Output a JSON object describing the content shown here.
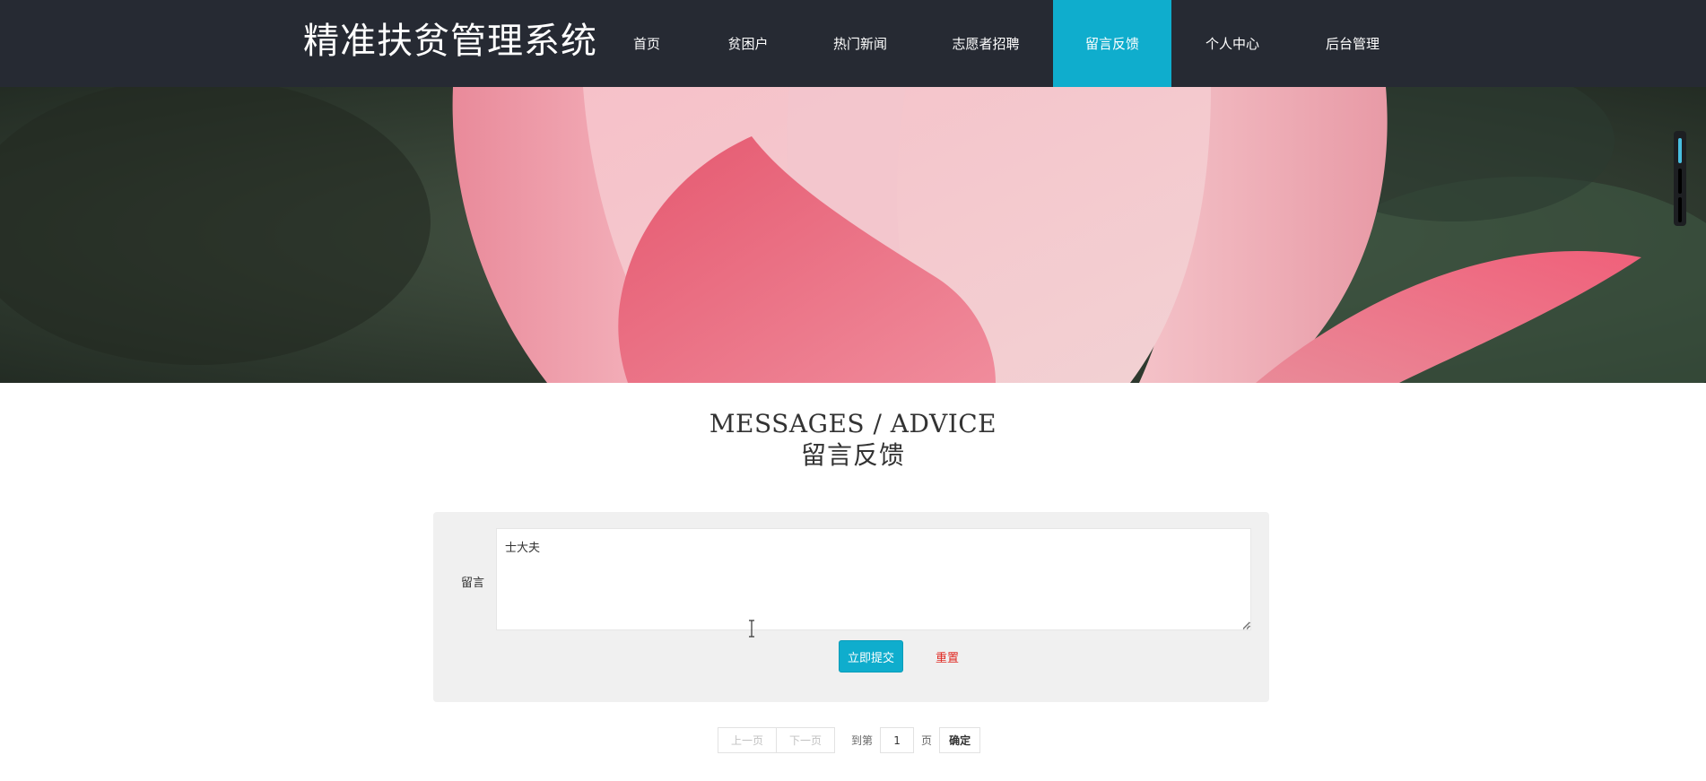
{
  "header": {
    "logo": "精准扶贫管理系统",
    "nav": [
      {
        "label": "首页"
      },
      {
        "label": "贫困户"
      },
      {
        "label": "热门新闻"
      },
      {
        "label": "志愿者招聘"
      },
      {
        "label": "留言反馈"
      },
      {
        "label": "个人中心"
      },
      {
        "label": "后台管理"
      }
    ],
    "active_index": 4
  },
  "page": {
    "title_en": "MESSAGES / ADVICE",
    "title_zh": "留言反馈"
  },
  "form": {
    "message_label": "留言",
    "message_value": "士大夫",
    "submit_label": "立即提交",
    "reset_label": "重置"
  },
  "pagination": {
    "prev_label": "上一页",
    "next_label": "下一页",
    "goto_label": "到第",
    "page_value": "1",
    "page_unit": "页",
    "confirm_label": "确定"
  },
  "colors": {
    "header_bg": "#262a33",
    "accent": "#0fadcd",
    "reset_red": "#e02a23",
    "form_bg": "#f0f0f0"
  }
}
